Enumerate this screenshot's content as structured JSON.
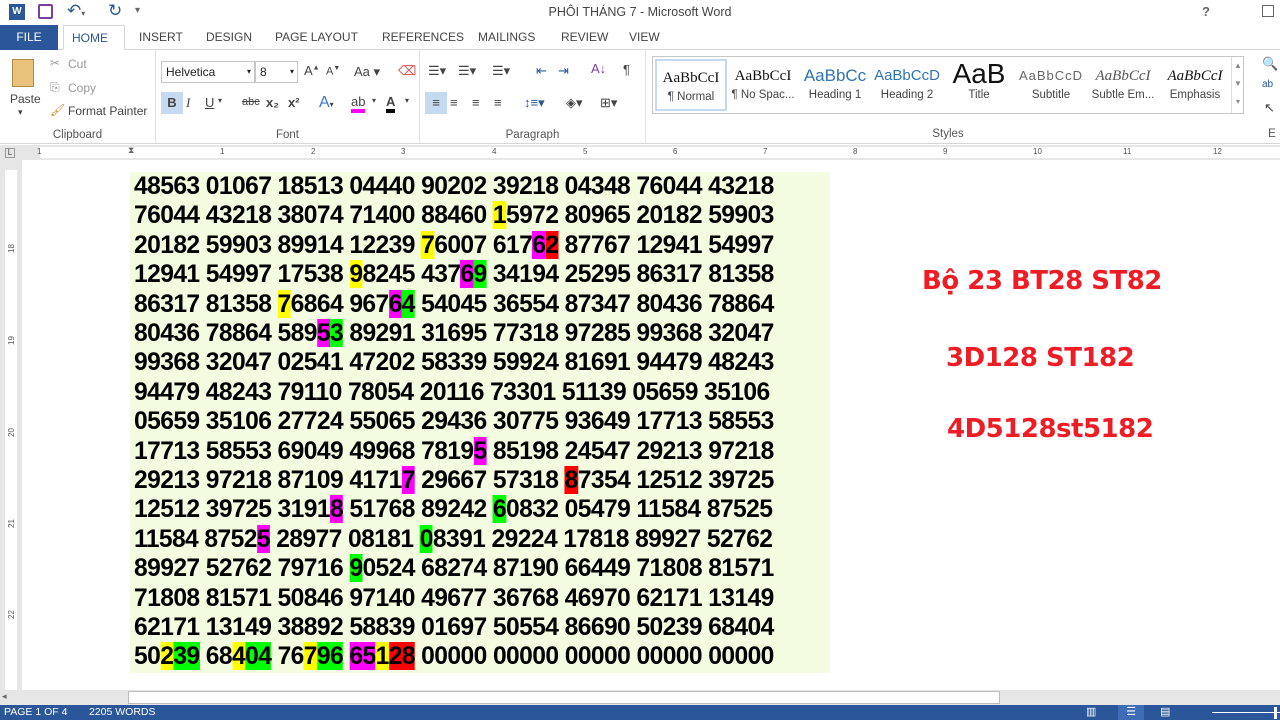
{
  "window": {
    "title": "PHÔI THÁNG 7 - Microsoft Word",
    "help": "?"
  },
  "tabs": [
    "FILE",
    "HOME",
    "INSERT",
    "DESIGN",
    "PAGE LAYOUT",
    "REFERENCES",
    "MAILINGS",
    "REVIEW",
    "VIEW"
  ],
  "active_tab": "HOME",
  "clipboard": {
    "paste": "Paste",
    "cut": "Cut",
    "copy": "Copy",
    "format_painter": "Format Painter",
    "label": "Clipboard"
  },
  "font": {
    "name": "Helvetica",
    "size": "8",
    "label": "Font",
    "change_case": "Aa",
    "bold": "B",
    "italic": "I",
    "underline": "U",
    "strike": "abc",
    "sub": "x₂",
    "sup": "x²",
    "highlight_color": "#ff00ff",
    "font_color": "#000000"
  },
  "paragraph": {
    "label": "Paragraph"
  },
  "styles": {
    "label": "Styles",
    "items": [
      {
        "preview": "AaBbCcI",
        "name": "¶ Normal"
      },
      {
        "preview": "AaBbCcI",
        "name": "¶ No Spac..."
      },
      {
        "preview": "AaBbCc",
        "name": "Heading 1"
      },
      {
        "preview": "AaBbCcD",
        "name": "Heading 2"
      },
      {
        "preview": "AaB",
        "name": "Title"
      },
      {
        "preview": "AaBbCcD",
        "name": "Subtitle"
      },
      {
        "preview": "AaBbCcI",
        "name": "Subtle Em..."
      },
      {
        "preview": "AaBbCcI",
        "name": "Emphasis"
      }
    ]
  },
  "editing": {
    "label": "E"
  },
  "ruler": {
    "h": [
      "1",
      "1",
      "2",
      "3",
      "4",
      "5",
      "6",
      "7",
      "8",
      "9",
      "10",
      "11",
      "12"
    ],
    "v": [
      "18",
      "19",
      "20",
      "21",
      "22"
    ]
  },
  "highlight_colors": {
    "y": "#ffff00",
    "m": "#ff00ff",
    "g": "#00ff00",
    "r": "#ff0000"
  },
  "grid_rows": [
    [
      [
        "48563 01067 18513 04440 90202 39218 04348 76044 43218",
        ""
      ]
    ],
    [
      [
        "76044 43218 38074 71400 88460 ",
        ""
      ],
      [
        "1",
        "y"
      ],
      [
        "5972 80965 20182 59903",
        ""
      ]
    ],
    [
      [
        "20182 59903 89914 12239 ",
        ""
      ],
      [
        "7",
        "y"
      ],
      [
        "6007 617",
        ""
      ],
      [
        "6",
        "m"
      ],
      [
        "2",
        "r"
      ],
      [
        " 87767 12941 54997",
        ""
      ]
    ],
    [
      [
        "12941 54997 17538 ",
        ""
      ],
      [
        "9",
        "y"
      ],
      [
        "8245 437",
        ""
      ],
      [
        "6",
        "m"
      ],
      [
        "9",
        "g"
      ],
      [
        " 34194 25295 86317 81358",
        ""
      ]
    ],
    [
      [
        "86317 81358 ",
        ""
      ],
      [
        "7",
        "y"
      ],
      [
        "6864 967",
        ""
      ],
      [
        "6",
        "m"
      ],
      [
        "4",
        "g"
      ],
      [
        " 54045 36554 87347 80436 78864",
        ""
      ]
    ],
    [
      [
        "80436 78864 589",
        ""
      ],
      [
        "5",
        "m"
      ],
      [
        "3",
        "g"
      ],
      [
        " 89291 31695 77318 97285 99368 32047",
        ""
      ]
    ],
    [
      [
        "99368 32047 02541 47202 58339 59924 81691 94479 48243",
        ""
      ]
    ],
    [
      [
        "94479 48243 79110 78054 20116 73301 51139 05659 35106",
        ""
      ]
    ],
    [
      [
        "05659 35106 27724 55065 29436 30775 93649 17713 58553",
        ""
      ]
    ],
    [
      [
        "17713 58553 69049 49968 7819",
        ""
      ],
      [
        "5",
        "m"
      ],
      [
        " 85198 24547 29213 97218",
        ""
      ]
    ],
    [
      [
        "29213 97218 87109 4171",
        ""
      ],
      [
        "7",
        "m"
      ],
      [
        " 29667 57318 ",
        ""
      ],
      [
        "8",
        "r"
      ],
      [
        "7354 12512 39725",
        ""
      ]
    ],
    [
      [
        "12512 39725 3191",
        ""
      ],
      [
        "8",
        "m"
      ],
      [
        " 51768 89242 ",
        ""
      ],
      [
        "6",
        "g"
      ],
      [
        "0832 05479 11584 87525",
        ""
      ]
    ],
    [
      [
        "11584 8752",
        ""
      ],
      [
        "5",
        "m"
      ],
      [
        " 28977 08181 ",
        ""
      ],
      [
        "0",
        "g"
      ],
      [
        "8391 29224 17818 89927 52762",
        ""
      ]
    ],
    [
      [
        "89927 52762 79716 ",
        ""
      ],
      [
        "9",
        "g"
      ],
      [
        "0524 68274 87190 66449 71808 81571",
        ""
      ]
    ],
    [
      [
        "71808 81571 50846 97140 49677 36768 46970 62171 13149",
        ""
      ]
    ],
    [
      [
        "62171 13149 38892 58839 01697 50554 86690 50239 68404",
        ""
      ]
    ],
    [
      [
        "50",
        ""
      ],
      [
        "2",
        "y"
      ],
      [
        "39",
        "g"
      ],
      [
        " 68",
        ""
      ],
      [
        "4",
        "y"
      ],
      [
        "04",
        "g"
      ],
      [
        " 76",
        ""
      ],
      [
        "7",
        "y"
      ],
      [
        "96",
        "g"
      ],
      [
        " ",
        ""
      ],
      [
        "65",
        "m"
      ],
      [
        "1",
        "y"
      ],
      [
        "28",
        "r"
      ],
      [
        " 00000 00000 00000 00000 00000",
        ""
      ]
    ]
  ],
  "notes": [
    "Bộ 23 BT28 ST82",
    "3D128 ST182",
    "4D5128st5182"
  ],
  "notes_color": "#ee1c25",
  "status": {
    "page": "PAGE 1 OF 4",
    "words": "2205 WORDS"
  }
}
